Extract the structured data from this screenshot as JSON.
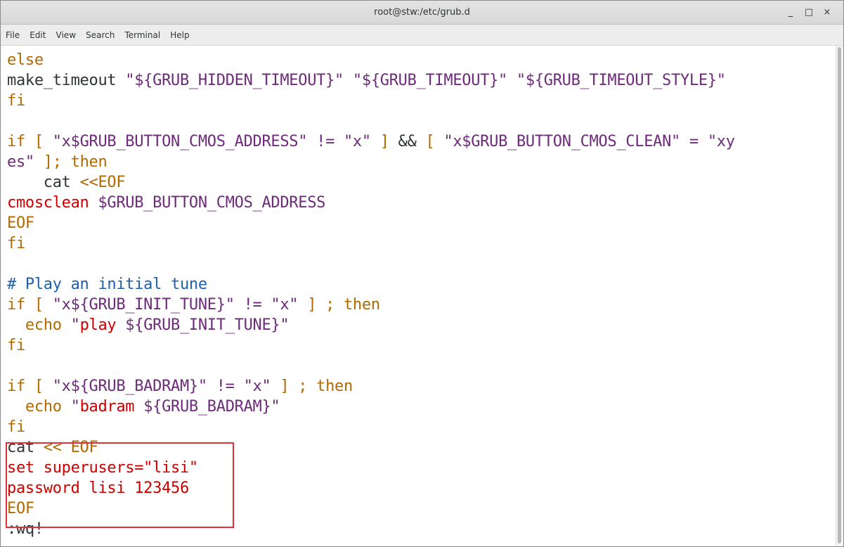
{
  "window": {
    "title": "root@stw:/etc/grub.d",
    "minimize_glyph": "_",
    "maximize_glyph": "□",
    "close_glyph": "×"
  },
  "menu": [
    "File",
    "Edit",
    "View",
    "Search",
    "Terminal",
    "Help"
  ],
  "colors": {
    "keyword": "#b06a00",
    "plain": "#2e3436",
    "string": "#6d2b7a",
    "comment": "#1f5faa",
    "red": "#cc0000",
    "highlight_box": "#e0303a"
  },
  "lines": [
    [
      {
        "t": "else",
        "c": "keyword"
      }
    ],
    [
      {
        "t": "make_timeout ",
        "c": "plain"
      },
      {
        "t": "\"${GRUB_HIDDEN_TIMEOUT}\" \"${GRUB_TIMEOUT}\" \"${GRUB_TIMEOUT_STYLE}\"",
        "c": "string"
      }
    ],
    [
      {
        "t": "fi",
        "c": "keyword"
      }
    ],
    [],
    [
      {
        "t": "if [ ",
        "c": "keyword"
      },
      {
        "t": "\"x$GRUB_BUTTON_CMOS_ADDRESS\" != \"x\"",
        "c": "string"
      },
      {
        "t": " ] ",
        "c": "keyword"
      },
      {
        "t": "&&",
        "c": "plain"
      },
      {
        "t": " [ ",
        "c": "keyword"
      },
      {
        "t": "\"x$GRUB_BUTTON_CMOS_CLEAN\" = \"xy",
        "c": "string"
      }
    ],
    [
      {
        "t": "es\"",
        "c": "string"
      },
      {
        "t": " ]; then",
        "c": "keyword"
      }
    ],
    [
      {
        "t": "    cat ",
        "c": "plain"
      },
      {
        "t": "<<EOF",
        "c": "keyword"
      }
    ],
    [
      {
        "t": "cmosclean ",
        "c": "red"
      },
      {
        "t": "$GRUB_BUTTON_CMOS_ADDRESS",
        "c": "string"
      }
    ],
    [
      {
        "t": "EOF",
        "c": "keyword"
      }
    ],
    [
      {
        "t": "fi",
        "c": "keyword"
      }
    ],
    [],
    [
      {
        "t": "# Play an initial tune",
        "c": "comment"
      }
    ],
    [
      {
        "t": "if [ ",
        "c": "keyword"
      },
      {
        "t": "\"x${GRUB_INIT_TUNE}\" != \"x\"",
        "c": "string"
      },
      {
        "t": " ] ; then",
        "c": "keyword"
      }
    ],
    [
      {
        "t": "  echo ",
        "c": "keyword"
      },
      {
        "t": "\"",
        "c": "string"
      },
      {
        "t": "play",
        "c": "red"
      },
      {
        "t": " ${GRUB_INIT_TUNE}\"",
        "c": "string"
      }
    ],
    [
      {
        "t": "fi",
        "c": "keyword"
      }
    ],
    [],
    [
      {
        "t": "if [ ",
        "c": "keyword"
      },
      {
        "t": "\"x${GRUB_BADRAM}\" != \"x\"",
        "c": "string"
      },
      {
        "t": " ] ; then",
        "c": "keyword"
      }
    ],
    [
      {
        "t": "  echo ",
        "c": "keyword"
      },
      {
        "t": "\"",
        "c": "string"
      },
      {
        "t": "badram",
        "c": "red"
      },
      {
        "t": " ${GRUB_BADRAM}\"",
        "c": "string"
      }
    ],
    [
      {
        "t": "fi",
        "c": "keyword"
      }
    ],
    [
      {
        "t": "cat ",
        "c": "plain"
      },
      {
        "t": "<< EOF",
        "c": "keyword"
      }
    ],
    [
      {
        "t": "set superusers=\"lisi\"",
        "c": "red"
      }
    ],
    [
      {
        "t": "password lisi 123456",
        "c": "red"
      }
    ],
    [
      {
        "t": "EOF",
        "c": "keyword"
      }
    ],
    [
      {
        "t": ":wq!",
        "c": "plain"
      }
    ]
  ]
}
